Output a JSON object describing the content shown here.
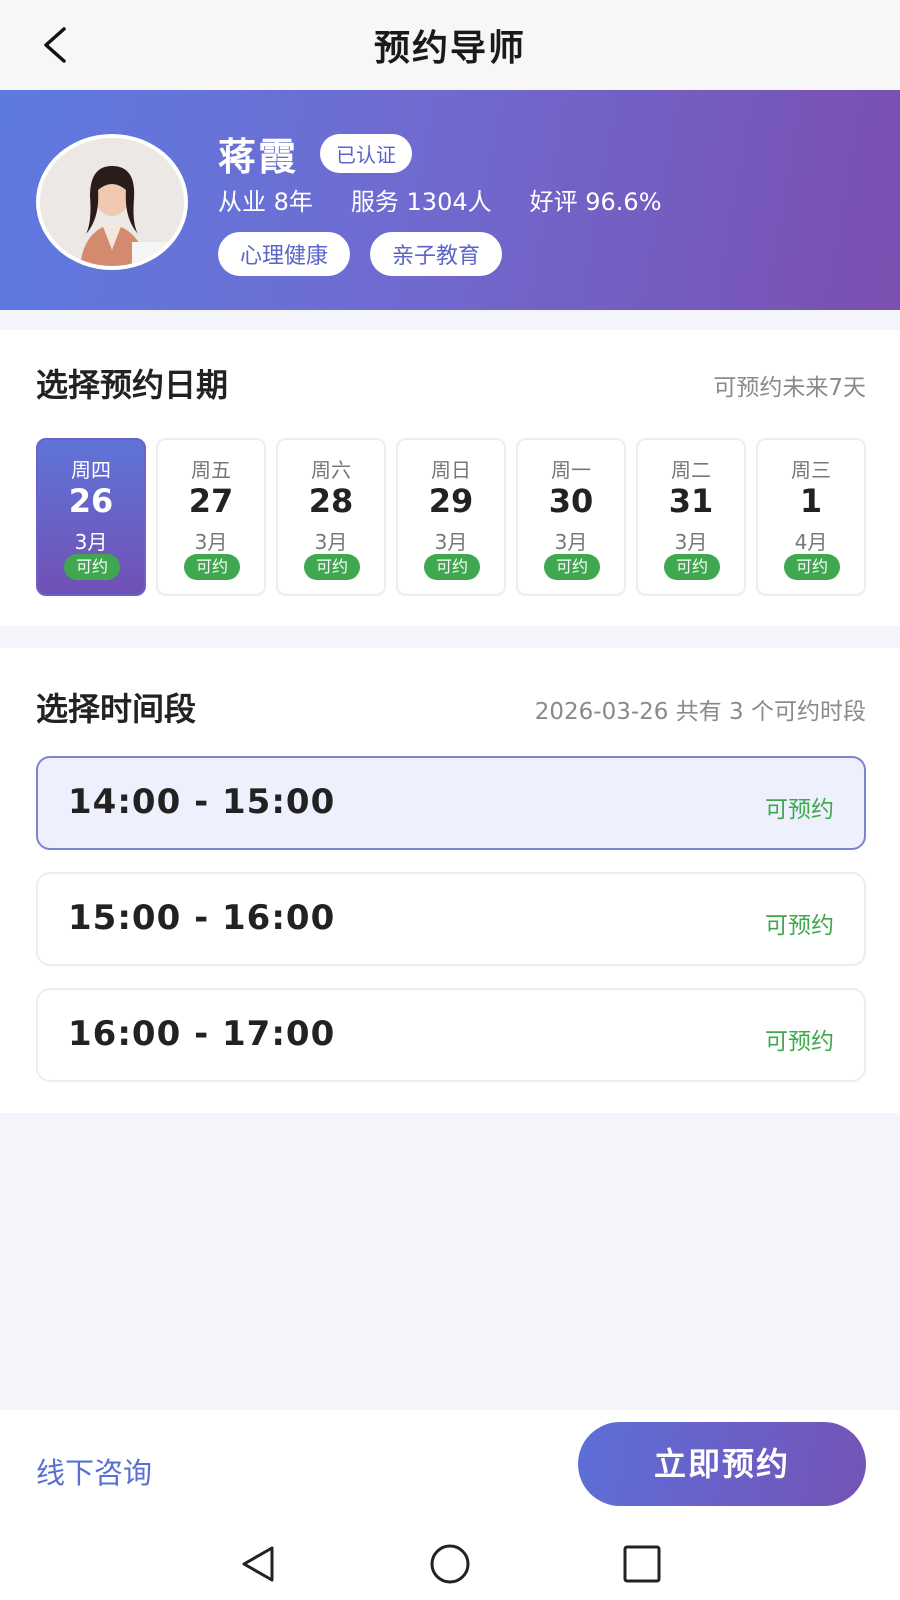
{
  "header": {
    "title": "预约导师"
  },
  "mentor": {
    "name": "蒋霞",
    "verified": "已认证",
    "stats": [
      "从业 8年",
      "服务 1304人",
      "好评 96.6%"
    ],
    "tags": [
      "心理健康",
      "亲子教育"
    ]
  },
  "date_section": {
    "title": "选择预约日期",
    "subtitle": "可预约未来7天",
    "dates": [
      {
        "week": "周四",
        "day": "26",
        "month": "3月",
        "status": "可约",
        "selected": true
      },
      {
        "week": "周五",
        "day": "27",
        "month": "3月",
        "status": "可约"
      },
      {
        "week": "周六",
        "day": "28",
        "month": "3月",
        "status": "可约"
      },
      {
        "week": "周日",
        "day": "29",
        "month": "3月",
        "status": "可约"
      },
      {
        "week": "周一",
        "day": "30",
        "month": "3月",
        "status": "可约"
      },
      {
        "week": "周二",
        "day": "31",
        "month": "3月",
        "status": "可约"
      },
      {
        "week": "周三",
        "day": "1",
        "month": "4月",
        "status": "可约"
      }
    ]
  },
  "time_section": {
    "title": "选择时间段",
    "subtitle": "2026-03-26 共有 3 个可约时段",
    "slots": [
      {
        "time": "14:00 - 15:00",
        "status": "可预约",
        "selected": true
      },
      {
        "time": "15:00 - 16:00",
        "status": "可预约"
      },
      {
        "time": "16:00 - 17:00",
        "status": "可预约"
      }
    ]
  },
  "bottom": {
    "offline_label": "线下咨询",
    "book_label": "立即预约"
  },
  "colors": {
    "accent": "#6a62c8",
    "available": "#3fa84f",
    "link": "#5a6fd3"
  }
}
